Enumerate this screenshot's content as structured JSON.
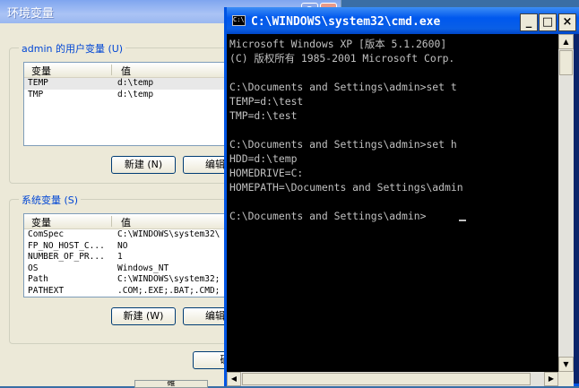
{
  "env_dialog": {
    "title": "环境变量",
    "help_icon": "?",
    "close_icon": "×",
    "user_section": {
      "legend": "admin 的用户变量 (U)",
      "columns": [
        "变量",
        "值"
      ],
      "rows": [
        {
          "name": "TEMP",
          "value": "d:\\temp"
        },
        {
          "name": "TMP",
          "value": "d:\\temp"
        }
      ],
      "new_label": "新建 (N)",
      "edit_label": "编辑"
    },
    "system_section": {
      "legend": "系统变量 (S)",
      "columns": [
        "变量",
        "值"
      ],
      "rows": [
        {
          "name": "ComSpec",
          "value": "C:\\WINDOWS\\system32\\"
        },
        {
          "name": "FP_NO_HOST_C...",
          "value": "NO"
        },
        {
          "name": "NUMBER_OF_PR...",
          "value": "1"
        },
        {
          "name": "OS",
          "value": "Windows_NT"
        },
        {
          "name": "Path",
          "value": "C:\\WINDOWS\\system32;"
        },
        {
          "name": "PATHEXT",
          "value": ".COM;.EXE;.BAT;.CMD;"
        }
      ],
      "new_label": "新建 (W)",
      "edit_label": "编辑"
    },
    "ok_label": "确",
    "underlying_tab_label": "確"
  },
  "cmd_window": {
    "title": "C:\\WINDOWS\\system32\\cmd.exe",
    "app_icon_text": "C:\\",
    "minimize_icon": "_",
    "maximize_icon": "□",
    "close_icon": "×",
    "output": "Microsoft Windows XP [版本 5.1.2600]\n(C) 版权所有 1985-2001 Microsoft Corp.\n\nC:\\Documents and Settings\\admin>set t\nTEMP=d:\\test\nTMP=d:\\test\n\nC:\\Documents and Settings\\admin>set h\nHDD=d:\\temp\nHOMEDRIVE=C:\nHOMEPATH=\\Documents and Settings\\admin\n\nC:\\Documents and Settings\\admin>",
    "scroll_up_icon": "▲",
    "scroll_down_icon": "▼",
    "scroll_left_icon": "◀",
    "scroll_right_icon": "▶"
  }
}
